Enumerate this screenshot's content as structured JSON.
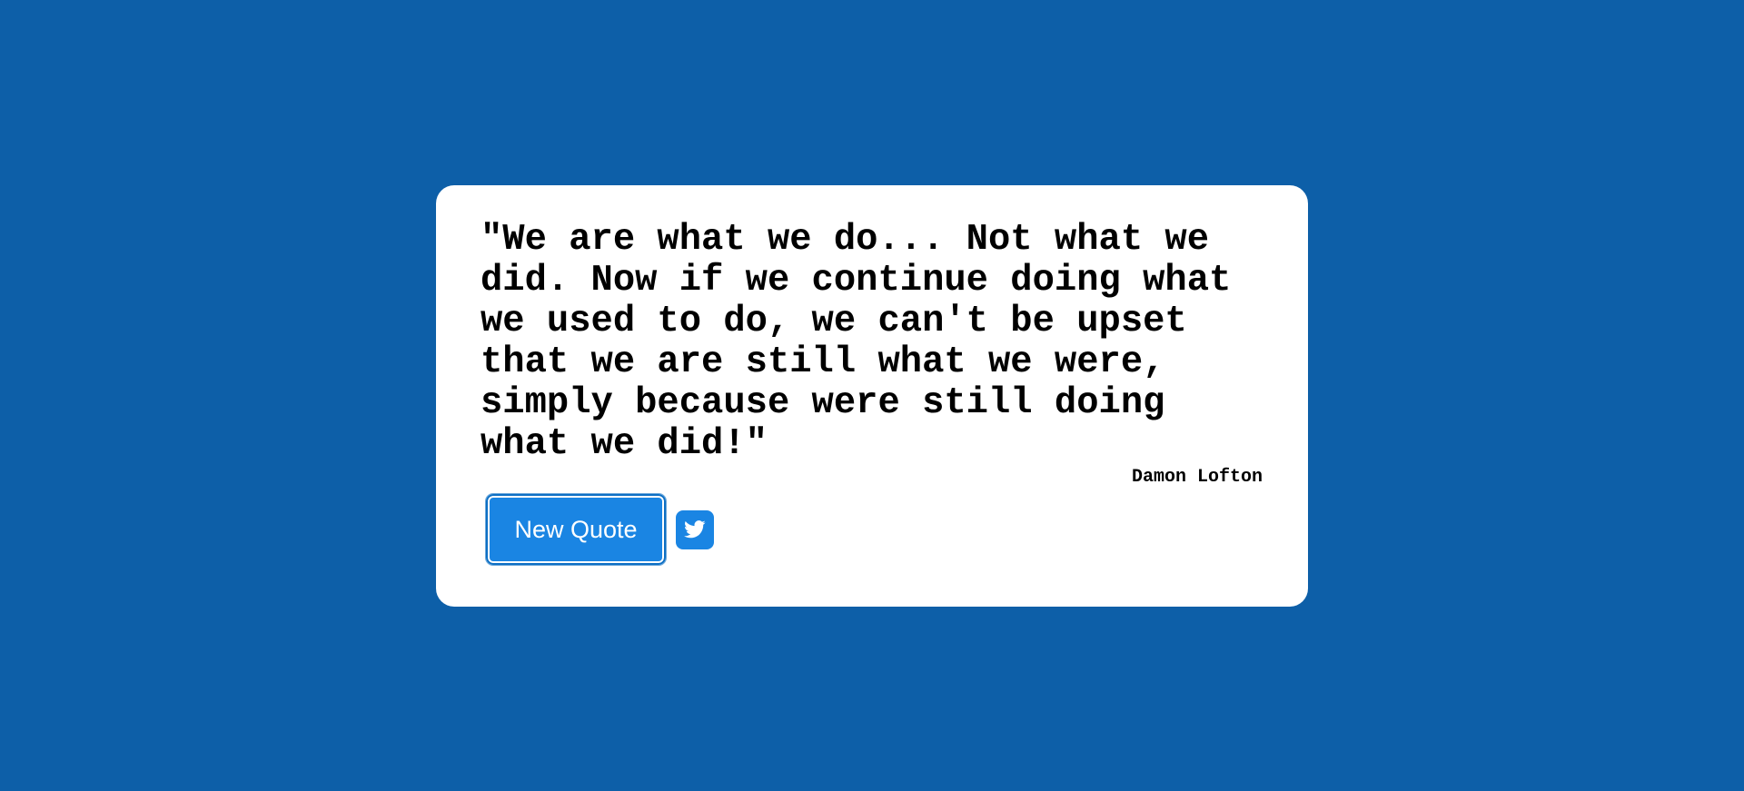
{
  "quote": {
    "text": "\"We are what we do... Not what we did. Now if we continue doing what we used to do, we can't be upset that we are still what we were, simply because were still doing what we did!\"",
    "author": "Damon Lofton"
  },
  "controls": {
    "new_quote_label": "New Quote",
    "tweet_icon": "twitter-icon"
  },
  "colors": {
    "background": "#0d5fa8",
    "card": "#ffffff",
    "accent": "#1a85e3",
    "text": "#000000"
  }
}
